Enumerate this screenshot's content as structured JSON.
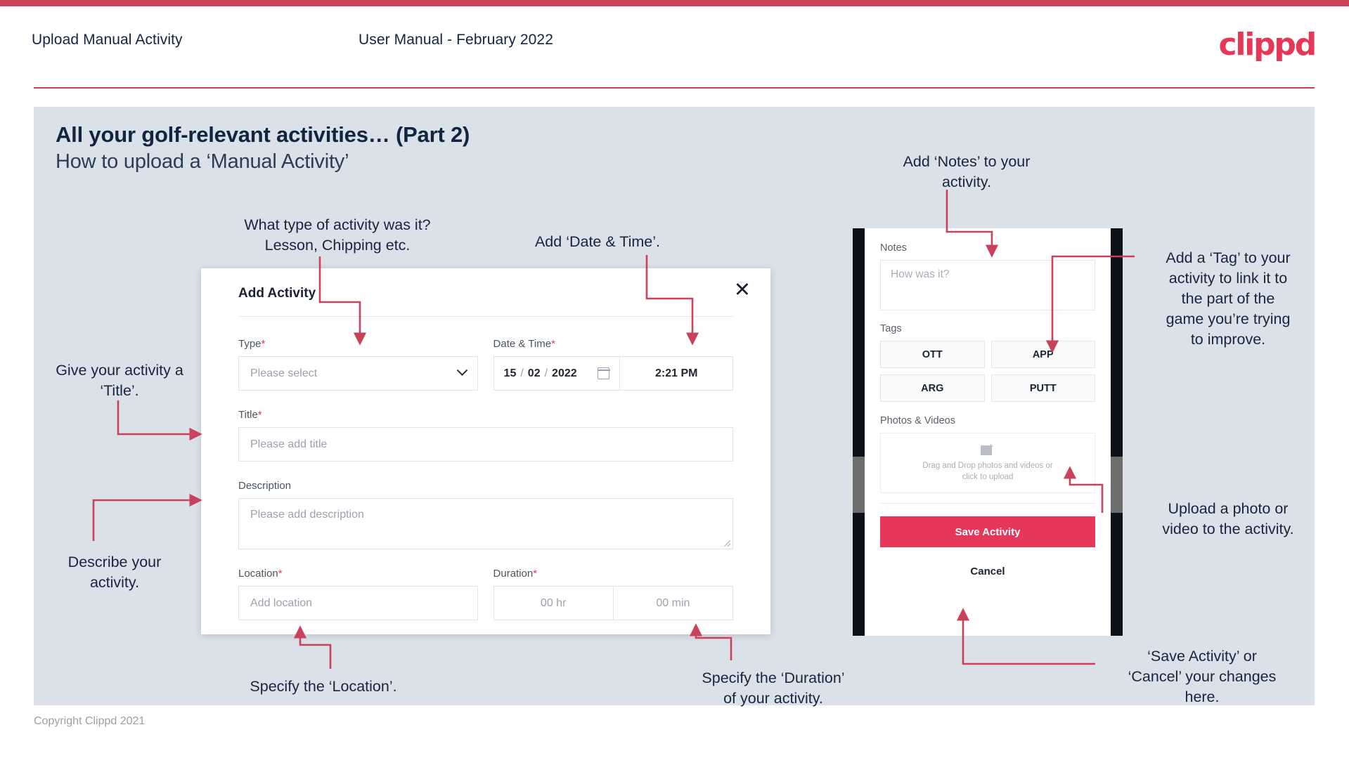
{
  "header": {
    "title": "Upload Manual Activity",
    "subtitle": "User Manual - February 2022",
    "logo": "clippd"
  },
  "slide": {
    "title": "All your golf-relevant activities… (Part 2)",
    "subtitle": "How to upload a ‘Manual Activity’"
  },
  "dialog": {
    "title": "Add Activity",
    "close_icon": "✕",
    "fields": {
      "type_label": "Type",
      "type_placeholder": "Please select",
      "datetime_label": "Date & Time",
      "date_day": "15",
      "date_month": "02",
      "date_year": "2022",
      "date_sep": "/",
      "time_value": "2:21 PM",
      "title_label": "Title",
      "title_placeholder": "Please add title",
      "description_label": "Description",
      "description_placeholder": "Please add description",
      "location_label": "Location",
      "location_placeholder": "Add location",
      "duration_label": "Duration",
      "duration_hours": "00 hr",
      "duration_minutes": "00 min"
    },
    "required_marker": "*"
  },
  "phone": {
    "notes_label": "Notes",
    "notes_placeholder": "How was it?",
    "tags_label": "Tags",
    "tags": [
      "OTT",
      "APP",
      "ARG",
      "PUTT"
    ],
    "photos_label": "Photos & Videos",
    "dropzone_line1": "Drag and Drop photos and videos or",
    "dropzone_line2": "click to upload",
    "save_label": "Save Activity",
    "cancel_label": "Cancel"
  },
  "annotations": {
    "type": "What type of activity was it?\nLesson, Chipping etc.",
    "datetime": "Add ‘Date & Time’.",
    "title": "Give your activity a\n‘Title’.",
    "description": "Describe your\nactivity.",
    "location": "Specify the ‘Location’.",
    "duration": "Specify the ‘Duration’\nof your activity.",
    "notes": "Add ‘Notes’ to your\nactivity.",
    "tags": "Add a ‘Tag’ to your\nactivity to link it to\nthe part of the\ngame you’re trying\nto improve.",
    "upload": "Upload a photo or\nvideo to the activity.",
    "save_cancel": "‘Save Activity’ or\n‘Cancel’ your changes\nhere."
  },
  "footer": {
    "copyright": "Copyright Clippd 2021"
  },
  "colors": {
    "accent": "#e6375a",
    "top_bar": "#cf4257",
    "arrow": "#c9415a",
    "slide_bg": "#dbe1e8",
    "text_dark": "#13243f"
  }
}
